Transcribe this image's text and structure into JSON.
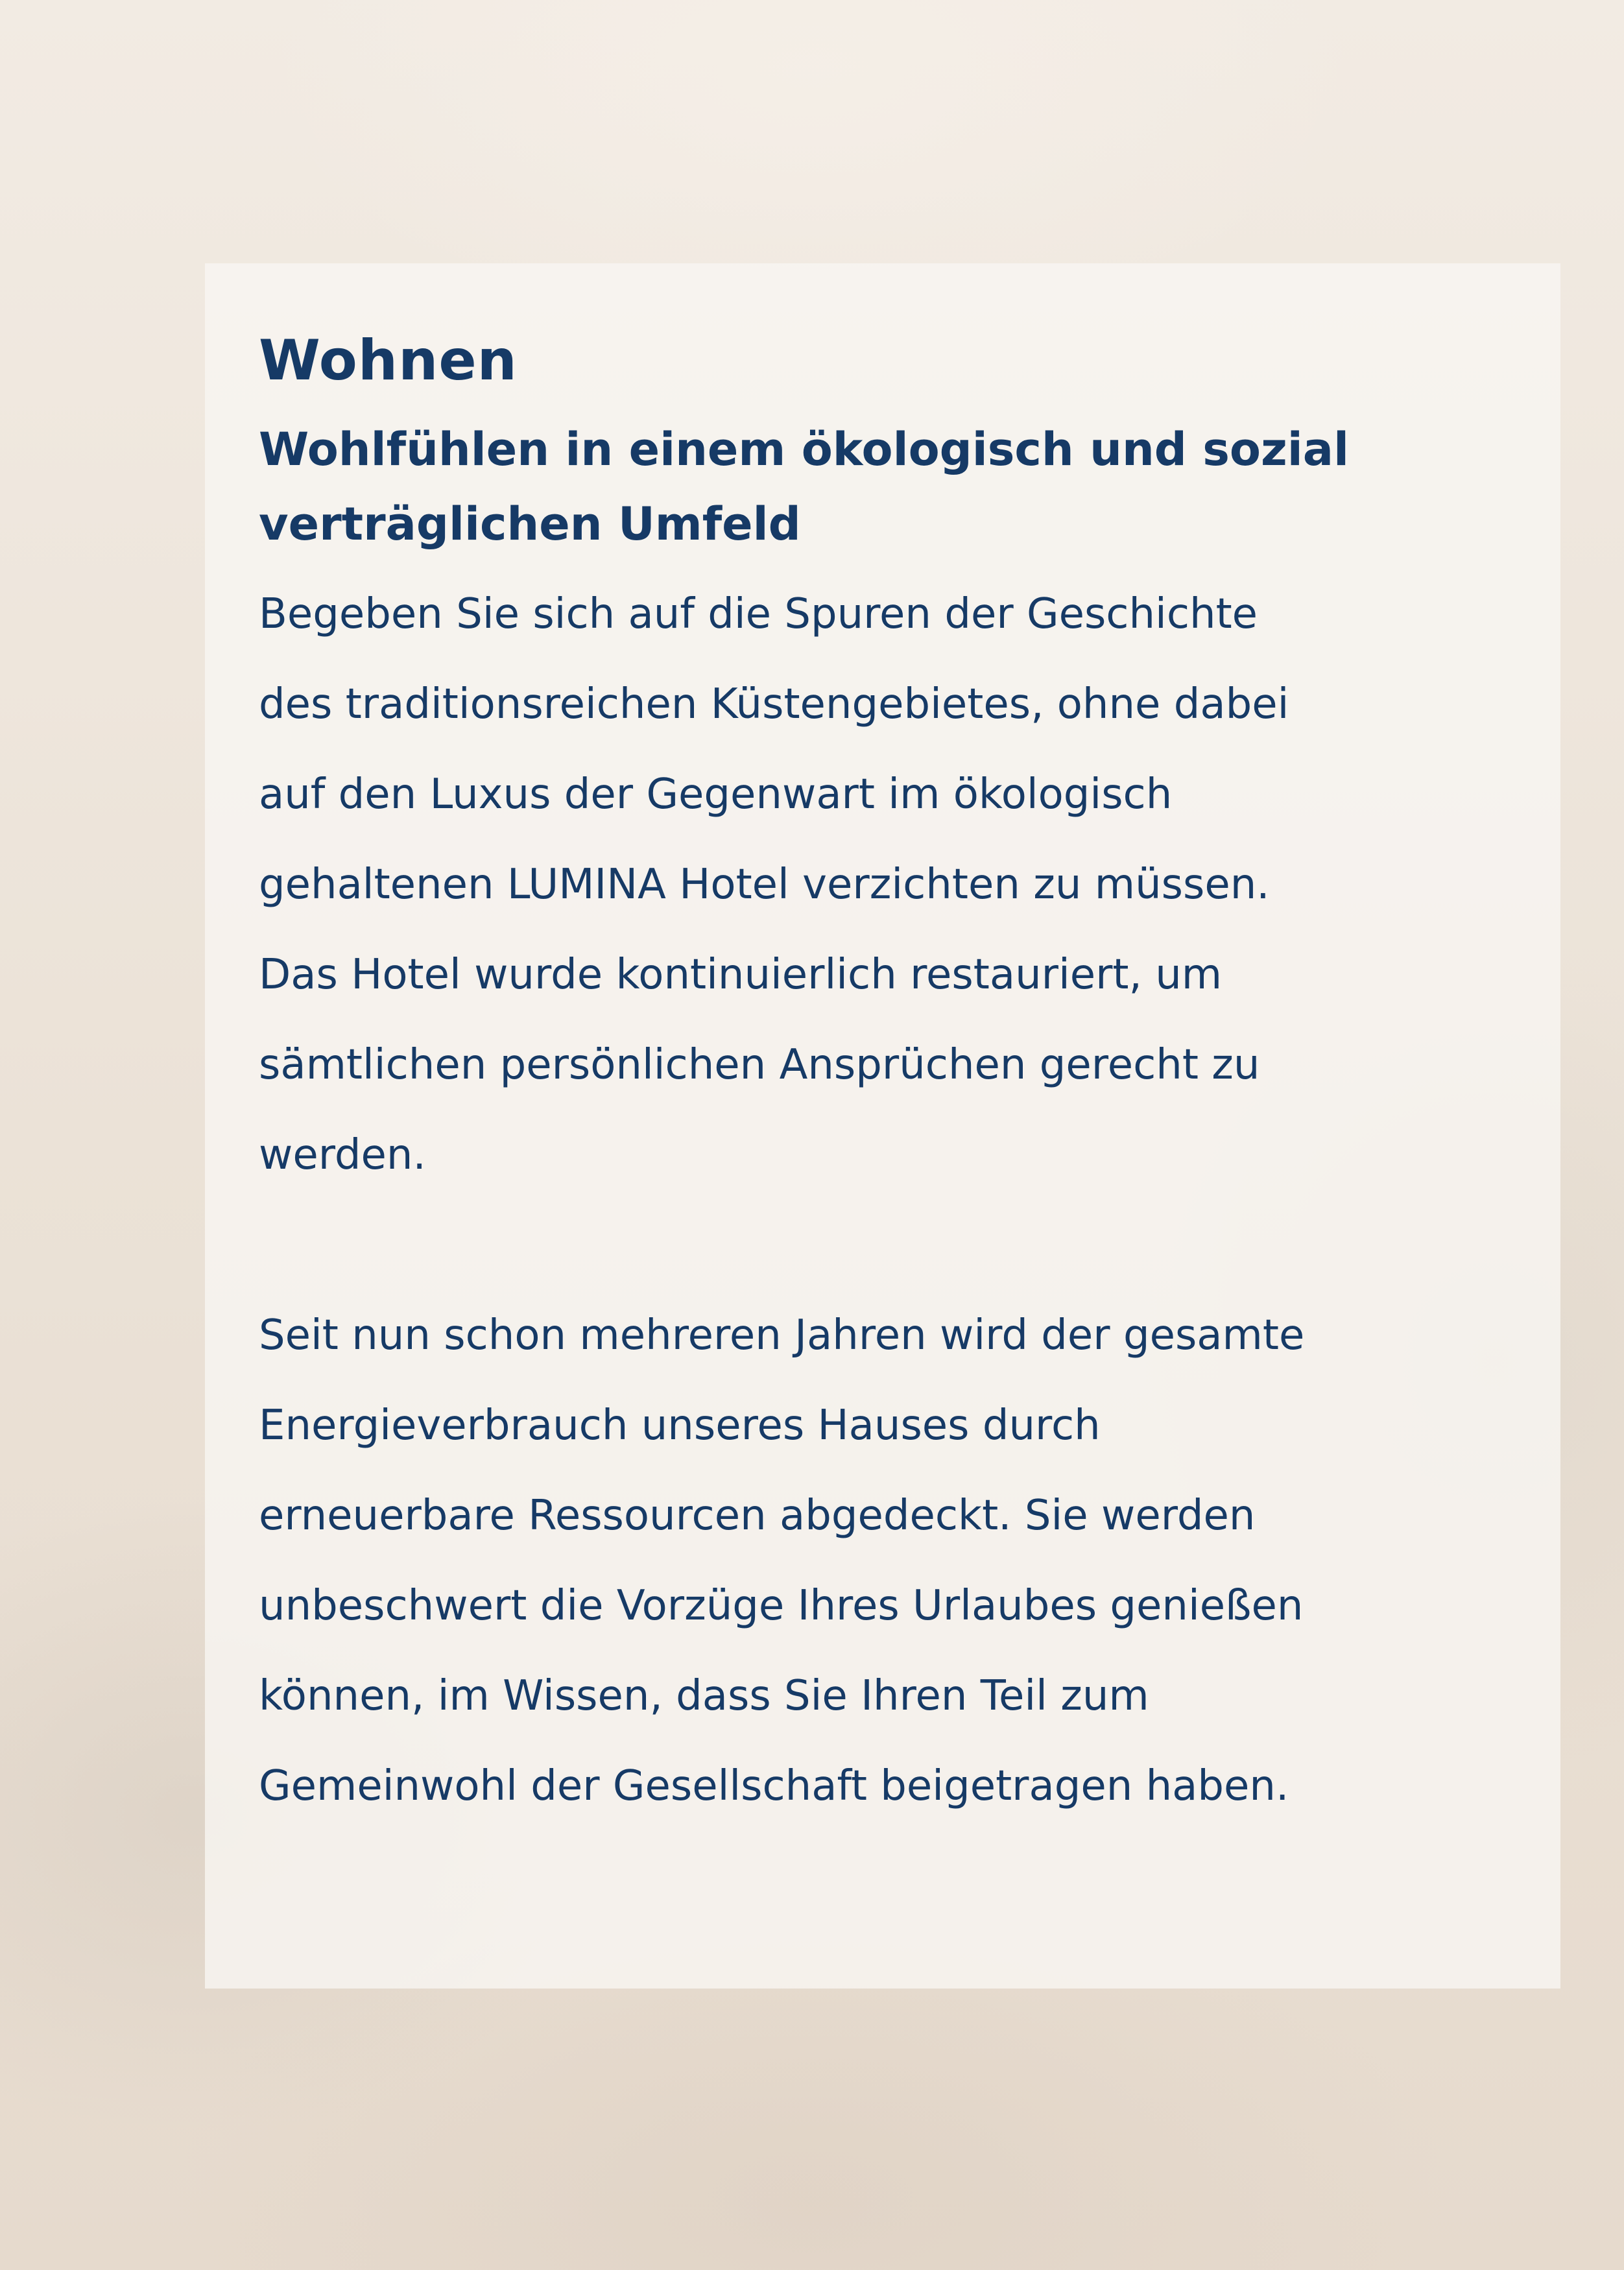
{
  "section": {
    "title": "Wohnen",
    "subtitle_lines": [
      "Wohlfühlen in einem ökologisch und sozial",
      "verträglichen Umfeld"
    ],
    "paragraph1_lines": [
      "Begeben Sie sich auf die Spuren der Geschichte",
      "des traditionsreichen Küstengebietes, ohne dabei",
      "auf den Luxus der Gegenwart im ökologisch",
      "gehaltenen LUMINA Hotel verzichten zu müssen.",
      "Das Hotel wurde kontinuierlich restauriert, um",
      "sämtlichen persönlichen Ansprüchen gerecht zu",
      "werden."
    ],
    "paragraph2_lines": [
      "Seit nun schon mehreren Jahren wird der gesamte",
      "Energieverbrauch unseres Hauses durch",
      "erneuerbare Ressourcen abgedeckt. Sie werden",
      "unbeschwert die Vorzüge Ihres Urlaubes genießen",
      "können, im Wissen, dass Sie Ihren Teil zum",
      "Gemeinwohl der Gesellschaft beigetragen haben."
    ]
  },
  "colors": {
    "text": "#163a66",
    "card": "#f8f5f1",
    "background": "#ece3d8"
  }
}
